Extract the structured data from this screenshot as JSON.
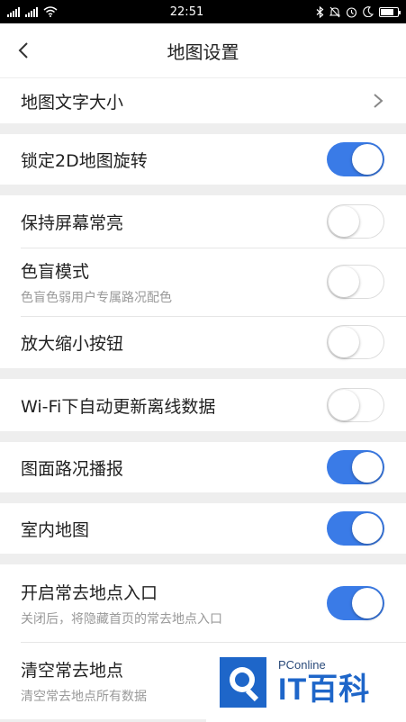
{
  "status_bar": {
    "time": "22:51",
    "left_icons": [
      "signal-icon",
      "signal-icon",
      "wifi-icon"
    ],
    "right_icons": [
      "bluetooth-icon",
      "mute-icon",
      "alarm-icon",
      "moon-icon",
      "battery-icon"
    ],
    "battery_level": 0.8
  },
  "header": {
    "title": "地图设置",
    "back_icon": "chevron-left-icon"
  },
  "groups": [
    {
      "items": [
        {
          "id": "map-text-size",
          "label": "地图文字大小",
          "control": "chevron"
        }
      ]
    },
    {
      "items": [
        {
          "id": "lock-2d-rotation",
          "label": "锁定2D地图旋转",
          "control": "toggle",
          "on": true
        }
      ]
    },
    {
      "items": [
        {
          "id": "keep-screen-on",
          "label": "保持屏幕常亮",
          "control": "toggle",
          "on": false
        },
        {
          "id": "color-blind-mode",
          "label": "色盲模式",
          "sub": "色盲色弱用户专属路况配色",
          "control": "toggle",
          "on": false
        },
        {
          "id": "zoom-buttons",
          "label": "放大缩小按钮",
          "control": "toggle",
          "on": false
        }
      ]
    },
    {
      "items": [
        {
          "id": "wifi-auto-update",
          "label": "Wi-Fi下自动更新离线数据",
          "control": "toggle",
          "on": false
        }
      ]
    },
    {
      "items": [
        {
          "id": "map-traffic-broadcast",
          "label": "图面路况播报",
          "control": "toggle",
          "on": true
        }
      ]
    },
    {
      "items": [
        {
          "id": "indoor-map",
          "label": "室内地图",
          "control": "toggle",
          "on": true
        }
      ]
    },
    {
      "items": [
        {
          "id": "frequent-places-entry",
          "label": "开启常去地点入口",
          "sub": "关闭后，将隐藏首页的常去地点入口",
          "control": "toggle",
          "on": true
        },
        {
          "id": "clear-frequent-places",
          "label": "清空常去地点",
          "sub": "清空常去地点所有数据",
          "control": "none"
        }
      ]
    }
  ],
  "colors": {
    "toggle_on": "#3a7be7",
    "background": "#eeeeee"
  },
  "watermark": {
    "top": "PConline",
    "bottom": "IT百科"
  }
}
